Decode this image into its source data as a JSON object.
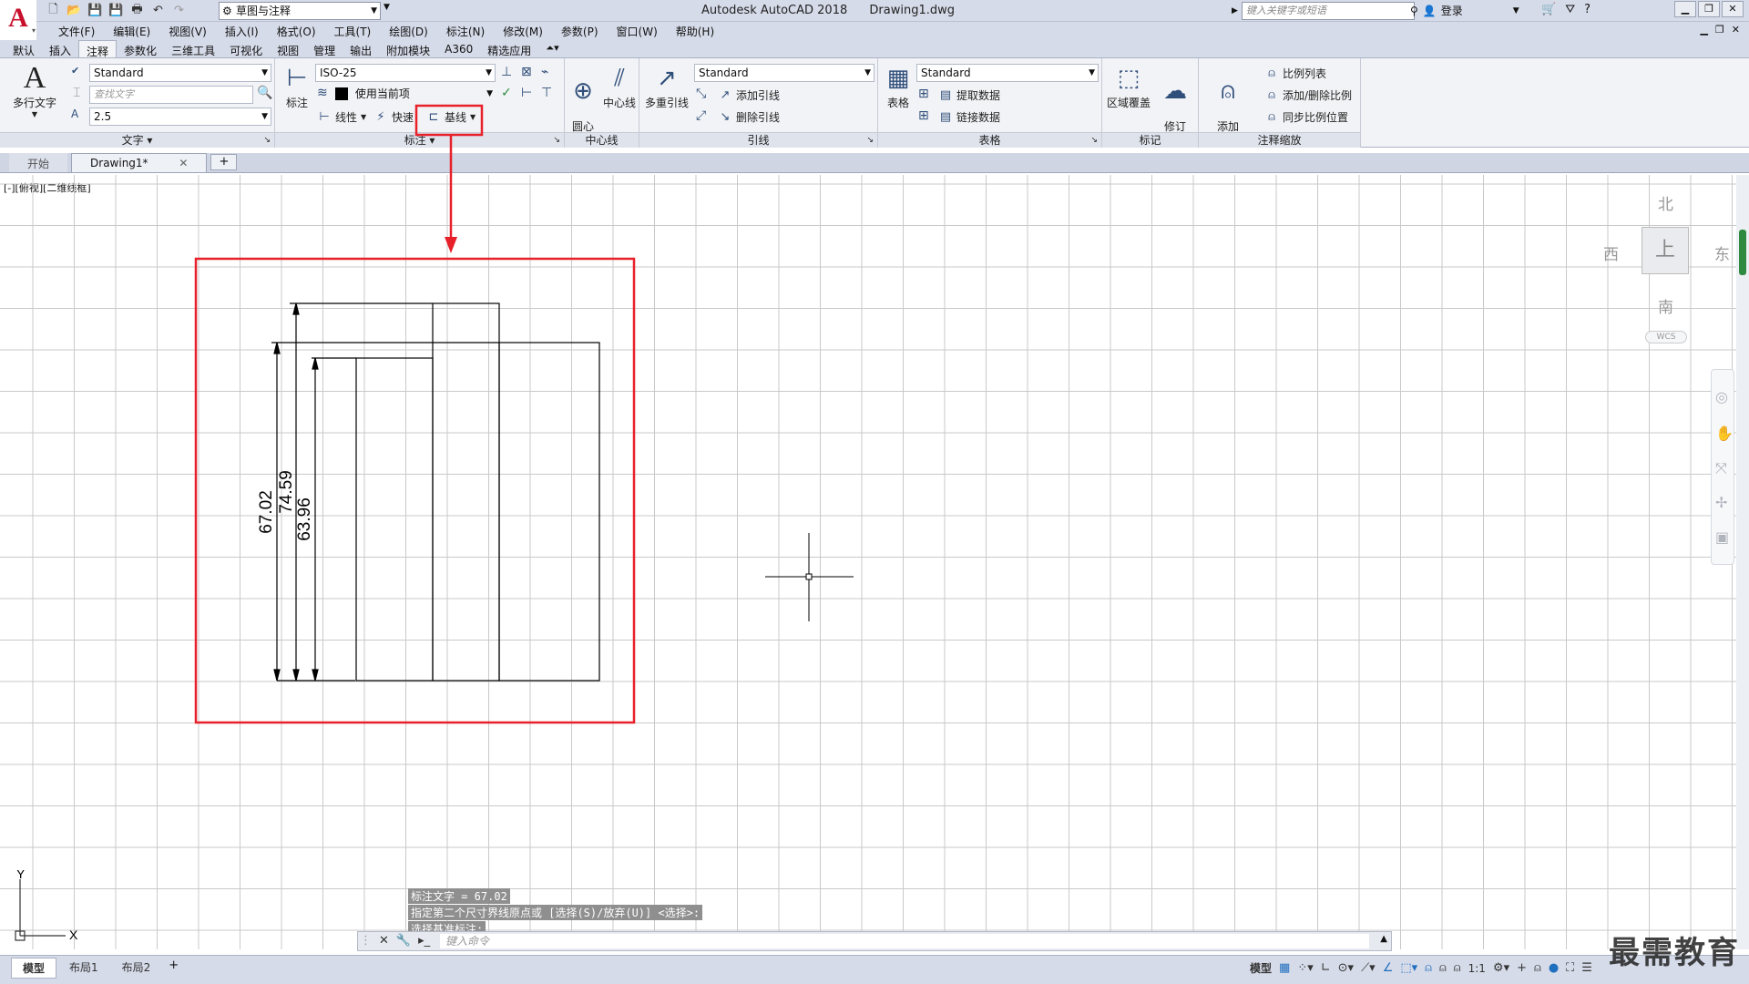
{
  "app": {
    "logo_letter": "A",
    "logo_dropdown": "▾",
    "title": "Autodesk AutoCAD 2018",
    "filename": "Drawing1.dwg",
    "workspace": "草图与注释",
    "search_placeholder": "键入关键字或短语",
    "signin": "登录"
  },
  "menu": [
    "文件(F)",
    "编辑(E)",
    "视图(V)",
    "插入(I)",
    "格式(O)",
    "工具(T)",
    "绘图(D)",
    "标注(N)",
    "修改(M)",
    "参数(P)",
    "窗口(W)",
    "帮助(H)"
  ],
  "ribbon_tabs": [
    "默认",
    "插入",
    "注释",
    "参数化",
    "三维工具",
    "可视化",
    "视图",
    "管理",
    "输出",
    "附加模块",
    "A360",
    "精选应用"
  ],
  "active_ribbon_tab": "注释",
  "ribbon": {
    "text_panel": {
      "title": "文字",
      "multiline_text": "多行文字",
      "text_style": "Standard",
      "find_placeholder": "查找文字",
      "text_height": "2.5"
    },
    "dimension_panel": {
      "title": "标注",
      "dimension_button": "标注",
      "dim_style": "ISO-25",
      "layer": "使用当前项",
      "linear": "线性",
      "quick": "快速",
      "baseline": "基线"
    },
    "centerline_panel": {
      "title": "中心线",
      "center_mark": "圆心\n标记",
      "centerline": "中心线"
    },
    "leader_panel": {
      "title": "引线",
      "multileader": "多重引线",
      "leader_style": "Standard",
      "add_leader": "添加引线",
      "remove_leader": "删除引线"
    },
    "table_panel": {
      "title": "表格",
      "table": "表格",
      "table_style": "Standard",
      "extract_data": "提取数据",
      "link_data": "链接数据"
    },
    "markup_panel": {
      "title": "标记",
      "wipeout": "区域覆盖",
      "revcloud": "修订\n云线"
    },
    "annotation_scaling_panel": {
      "title": "注释缩放",
      "add_current_scale": "添加\n当前比例",
      "scale_list": "比例列表",
      "add_delete_scales": "添加/删除比例",
      "sync_scale_positions": "同步比例位置"
    }
  },
  "doc_tabs": [
    "开始",
    "Drawing1*"
  ],
  "active_doc_tab": "Drawing1*",
  "viewport_label": "[-][俯视][二维线框]",
  "viewcube": {
    "north": "北",
    "south": "南",
    "east": "东",
    "west": "西",
    "face": "上",
    "wcs": "WCS"
  },
  "dimensions": [
    "67.02",
    "74.59",
    "63.96"
  ],
  "ucs": {
    "x": "X",
    "y": "Y"
  },
  "command": {
    "history": [
      "标注文字 = 67.02",
      "指定第二个尺寸界线原点或 [选择(S)/放弃(U)] <选择>:",
      "选择基准标注:"
    ],
    "placeholder": "键入命令"
  },
  "layout_tabs": [
    "模型",
    "布局1",
    "布局2"
  ],
  "status": {
    "model": "模型",
    "scale": "1:1"
  },
  "watermark": "最需教育",
  "colors": {
    "highlight": "#e8202a",
    "ribbon_bg": "#f2f3f6",
    "grid": "#c9c9c9"
  }
}
